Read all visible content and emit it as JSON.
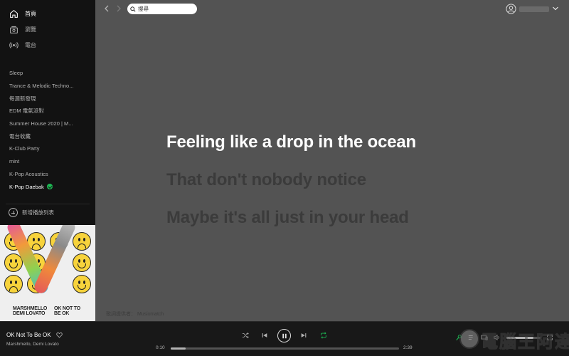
{
  "sidebar": {
    "nav": [
      {
        "label": "首頁",
        "icon": "home-icon"
      },
      {
        "label": "瀏覽",
        "icon": "browse-icon"
      },
      {
        "label": "電台",
        "icon": "radio-icon"
      }
    ],
    "playlists": [
      "Sleep",
      "Trance & Melodic Techno...",
      "每週新發現",
      "EDM 電氣派對",
      "Summer House 2020 | M...",
      "電台收藏",
      "K-Club Party",
      "mint",
      "K-Pop Acoustics",
      "K-Pop Daebak"
    ],
    "new_playlist": "新增播放列表",
    "album_art": {
      "artist_text": "MARSHMELLO DEMI LOVATO",
      "title_text": "OK NOT TO BE OK"
    }
  },
  "topbar": {
    "search_placeholder": "搜尋"
  },
  "lyrics": {
    "lines": [
      "Feeling like a drop in the ocean",
      "That don't nobody notice",
      "Maybe it's all just in your head"
    ],
    "current_index": 0,
    "credit": "歌詞提供者： Musixmatch"
  },
  "player": {
    "track_title": "OK Not To Be OK",
    "track_artist": "Marshmello, Demi Lovato",
    "elapsed": "0:10",
    "duration": "2:39",
    "progress_fraction": 0.065,
    "volume_fraction": 0.8,
    "watermark": "電腦王阿達"
  },
  "colors": {
    "accent": "#1db954",
    "main_bg": "#535353",
    "sidebar_bg": "#121212",
    "player_bg": "#181818"
  }
}
